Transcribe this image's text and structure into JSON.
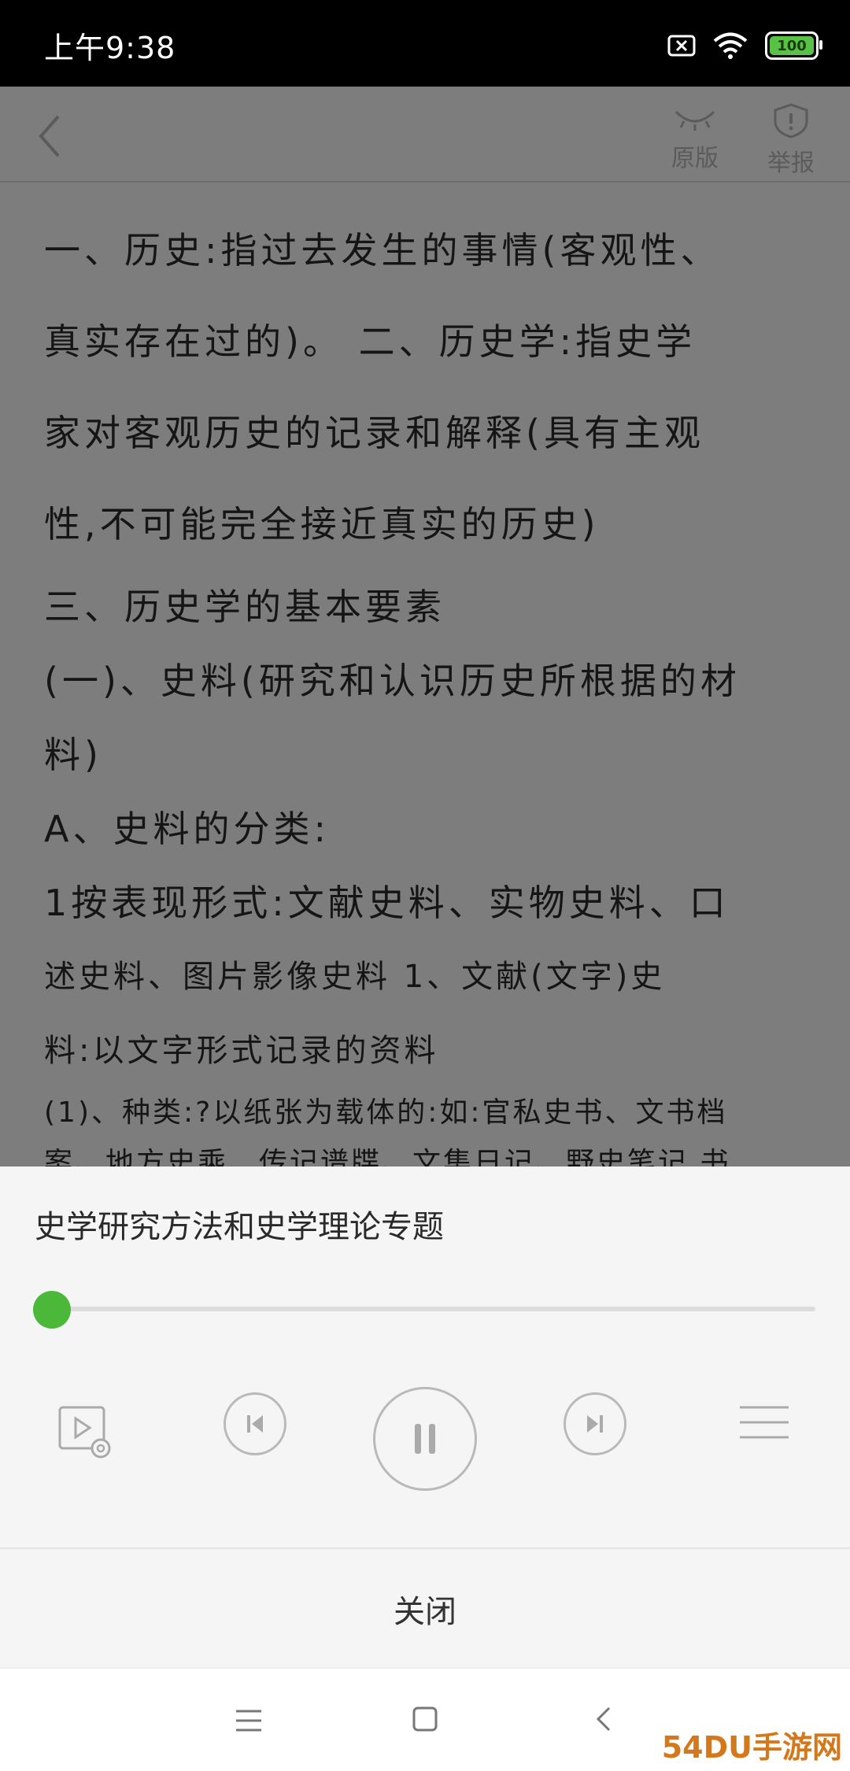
{
  "status_bar": {
    "time": "上午9:38",
    "battery": "100"
  },
  "toolbar": {
    "original_label": "原版",
    "report_label": "举报"
  },
  "content": {
    "lines": [
      "一、历史:指过去发生的事情(客观性、",
      "真实存在过的)。 二、历史学:指史学",
      "家对客观历史的记录和解释(具有主观",
      "性,不可能完全接近真实的历史)",
      "三、历史学的基本要素",
      "(一)、史料(研究和认识历史所根据的材",
      "料)",
      "A、史料的分类:",
      "1按表现形式:文献史料、实物史料、口",
      "述史料、图片影像史料 1、文献(文字)史",
      "料:以文字形式记录的资料",
      "(1)、种类:?以纸张为载体的:如:官私史书、文书档",
      "案、地方史乘、传记谱牒、文集日记、野史笔记,书"
    ]
  },
  "player": {
    "title": "史学研究方法和史学理论专题",
    "progress": 0.0
  },
  "close_label": "关闭",
  "watermark": "54DU手游网",
  "colors": {
    "accent": "#4cb83a",
    "overlay": "#7d7d7d",
    "panel": "#f5f5f5"
  }
}
